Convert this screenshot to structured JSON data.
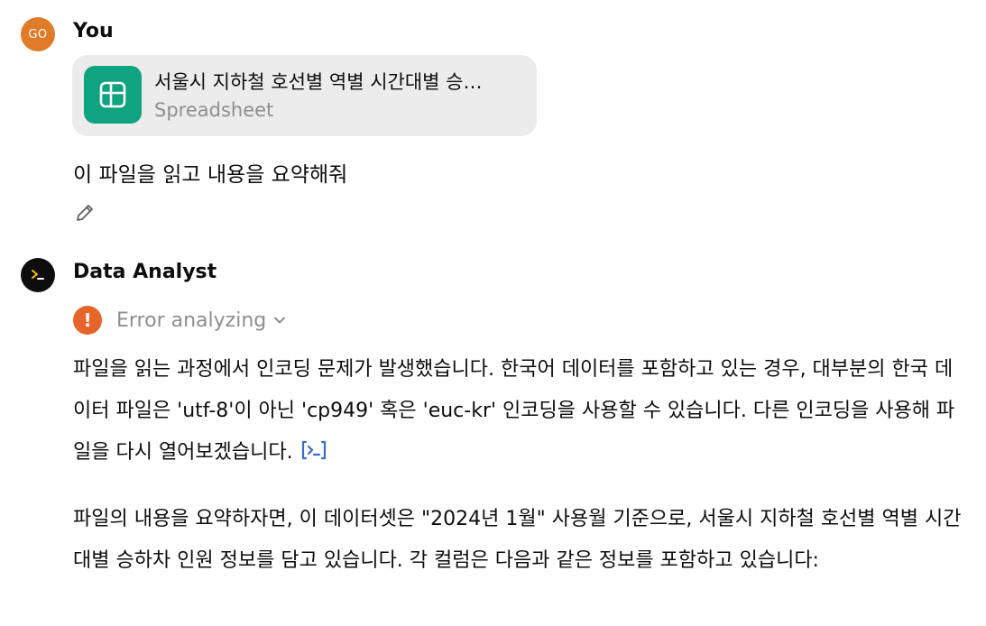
{
  "user_message": {
    "avatar_initials": "GO",
    "author": "You",
    "attachment": {
      "name": "서울시 지하철 호선별 역별 시간대별 승…",
      "type": "Spreadsheet",
      "icon": "table-icon"
    },
    "text": "이 파일을 읽고 내용을 요약해줘",
    "edit_icon": "pencil-icon"
  },
  "assistant_message": {
    "author": "Data Analyst",
    "avatar_icon": "terminal-prompt-icon",
    "status": {
      "label": "Error analyzing",
      "icon": "exclamation-icon",
      "expand_icon": "chevron-down-icon"
    },
    "paragraph_1": "파일을 읽는 과정에서 인코딩 문제가 발생했습니다. 한국어 데이터를 포함하고 있는 경우, 대부분의 한국 데이터 파일은 'utf-8'이 아닌 'cp949' 혹은 'euc-kr' 인코딩을 사용할 수 있습니다. 다른 인코딩을 사용해 파일을 다시 열어보겠습니다.",
    "code_link_icon": "code-interpreter-icon",
    "paragraph_2": "파일의 내용을 요약하자면, 이 데이터셋은 \"2024년 1월\" 사용월 기준으로, 서울시 지하철 호선별 역별 시간대별 승하차 인원 정보를 담고 있습니다. 각 컬럼은 다음과 같은 정보를 포함하고 있습니다:"
  },
  "colors": {
    "user_avatar": "#e07b2a",
    "spreadsheet_icon_bg": "#10a37f",
    "error_icon": "#e5652b",
    "attachment_bg": "#ececec",
    "muted_text": "#8e8e8e"
  }
}
